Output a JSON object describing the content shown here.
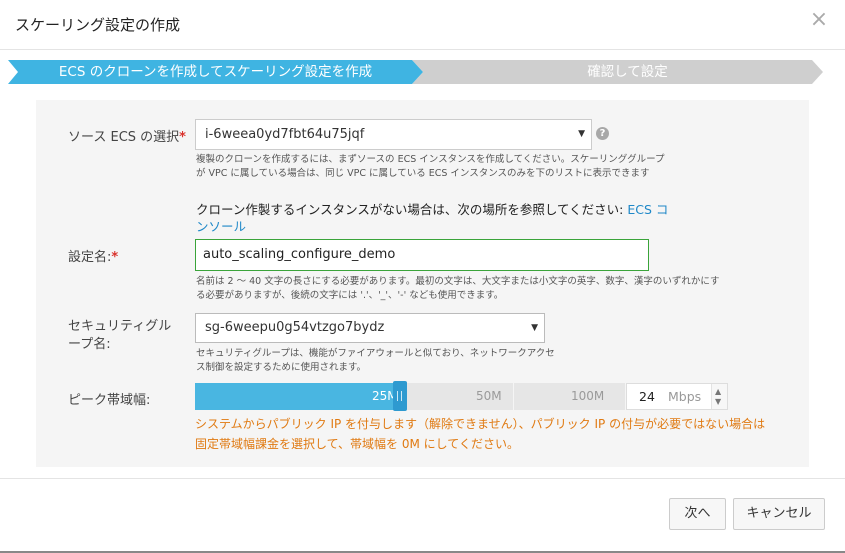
{
  "dialog": {
    "title": "スケーリング設定の作成",
    "close_icon": "×"
  },
  "steps": [
    {
      "label": "ECS のクローンを作成してスケーリング設定を作成",
      "active": true
    },
    {
      "label": "確認して設定",
      "active": false
    }
  ],
  "form": {
    "required_mark": "*",
    "source_ecs": {
      "label": "ソース ECS の選択",
      "value": "i-6weea0yd7fbt64u75jqf",
      "help_icon": "?",
      "hint": "複製のクローンを作成するには、まずソースの ECS インスタンスを作成してください。スケーリンググループが VPC に属している場合は、同じ VPC に属している ECS インスタンスのみを下のリストに表示できます",
      "note_text": "クローン作製するインスタンスがない場合は、次の場所を参照してください: ",
      "note_link": "ECS コンソール"
    },
    "config_name": {
      "label": "設定名:",
      "value": "auto_scaling_configure_demo",
      "hint": "名前は 2 ～ 40 文字の長さにする必要があります。最初の文字は、大文字または小文字の英字、数字、漢字のいずれかにする必要がありますが、後続の文字には '.'、'_'、'-' なども使用できます。"
    },
    "security_group": {
      "label_line1": "セキュリティグル",
      "label_line2": "ープ名:",
      "value": "sg-6weepu0g54vtzgo7bydz",
      "hint": "セキュリティグループは、機能がファイアウォールと似ており、ネットワークアクセス制御を設定するために使用されます。"
    },
    "bandwidth": {
      "label": "ピーク帯域幅:",
      "ticks": [
        "25M",
        "50M",
        "100M"
      ],
      "value": "24",
      "unit": "Mbps",
      "level_mbps": 24,
      "warning": "システムからパブリック IP を付与します（解除できません）、パブリック IP の付与が必要ではない場合は固定帯域幅課金を選択して、帯域幅を 0M にしてください。"
    }
  },
  "footer": {
    "next_label": "次へ",
    "cancel_label": "キャンセル"
  },
  "colors": {
    "accent": "#3fb4e2",
    "required": "#d9322c",
    "warning": "#e07a12",
    "link": "#1e88c8"
  }
}
